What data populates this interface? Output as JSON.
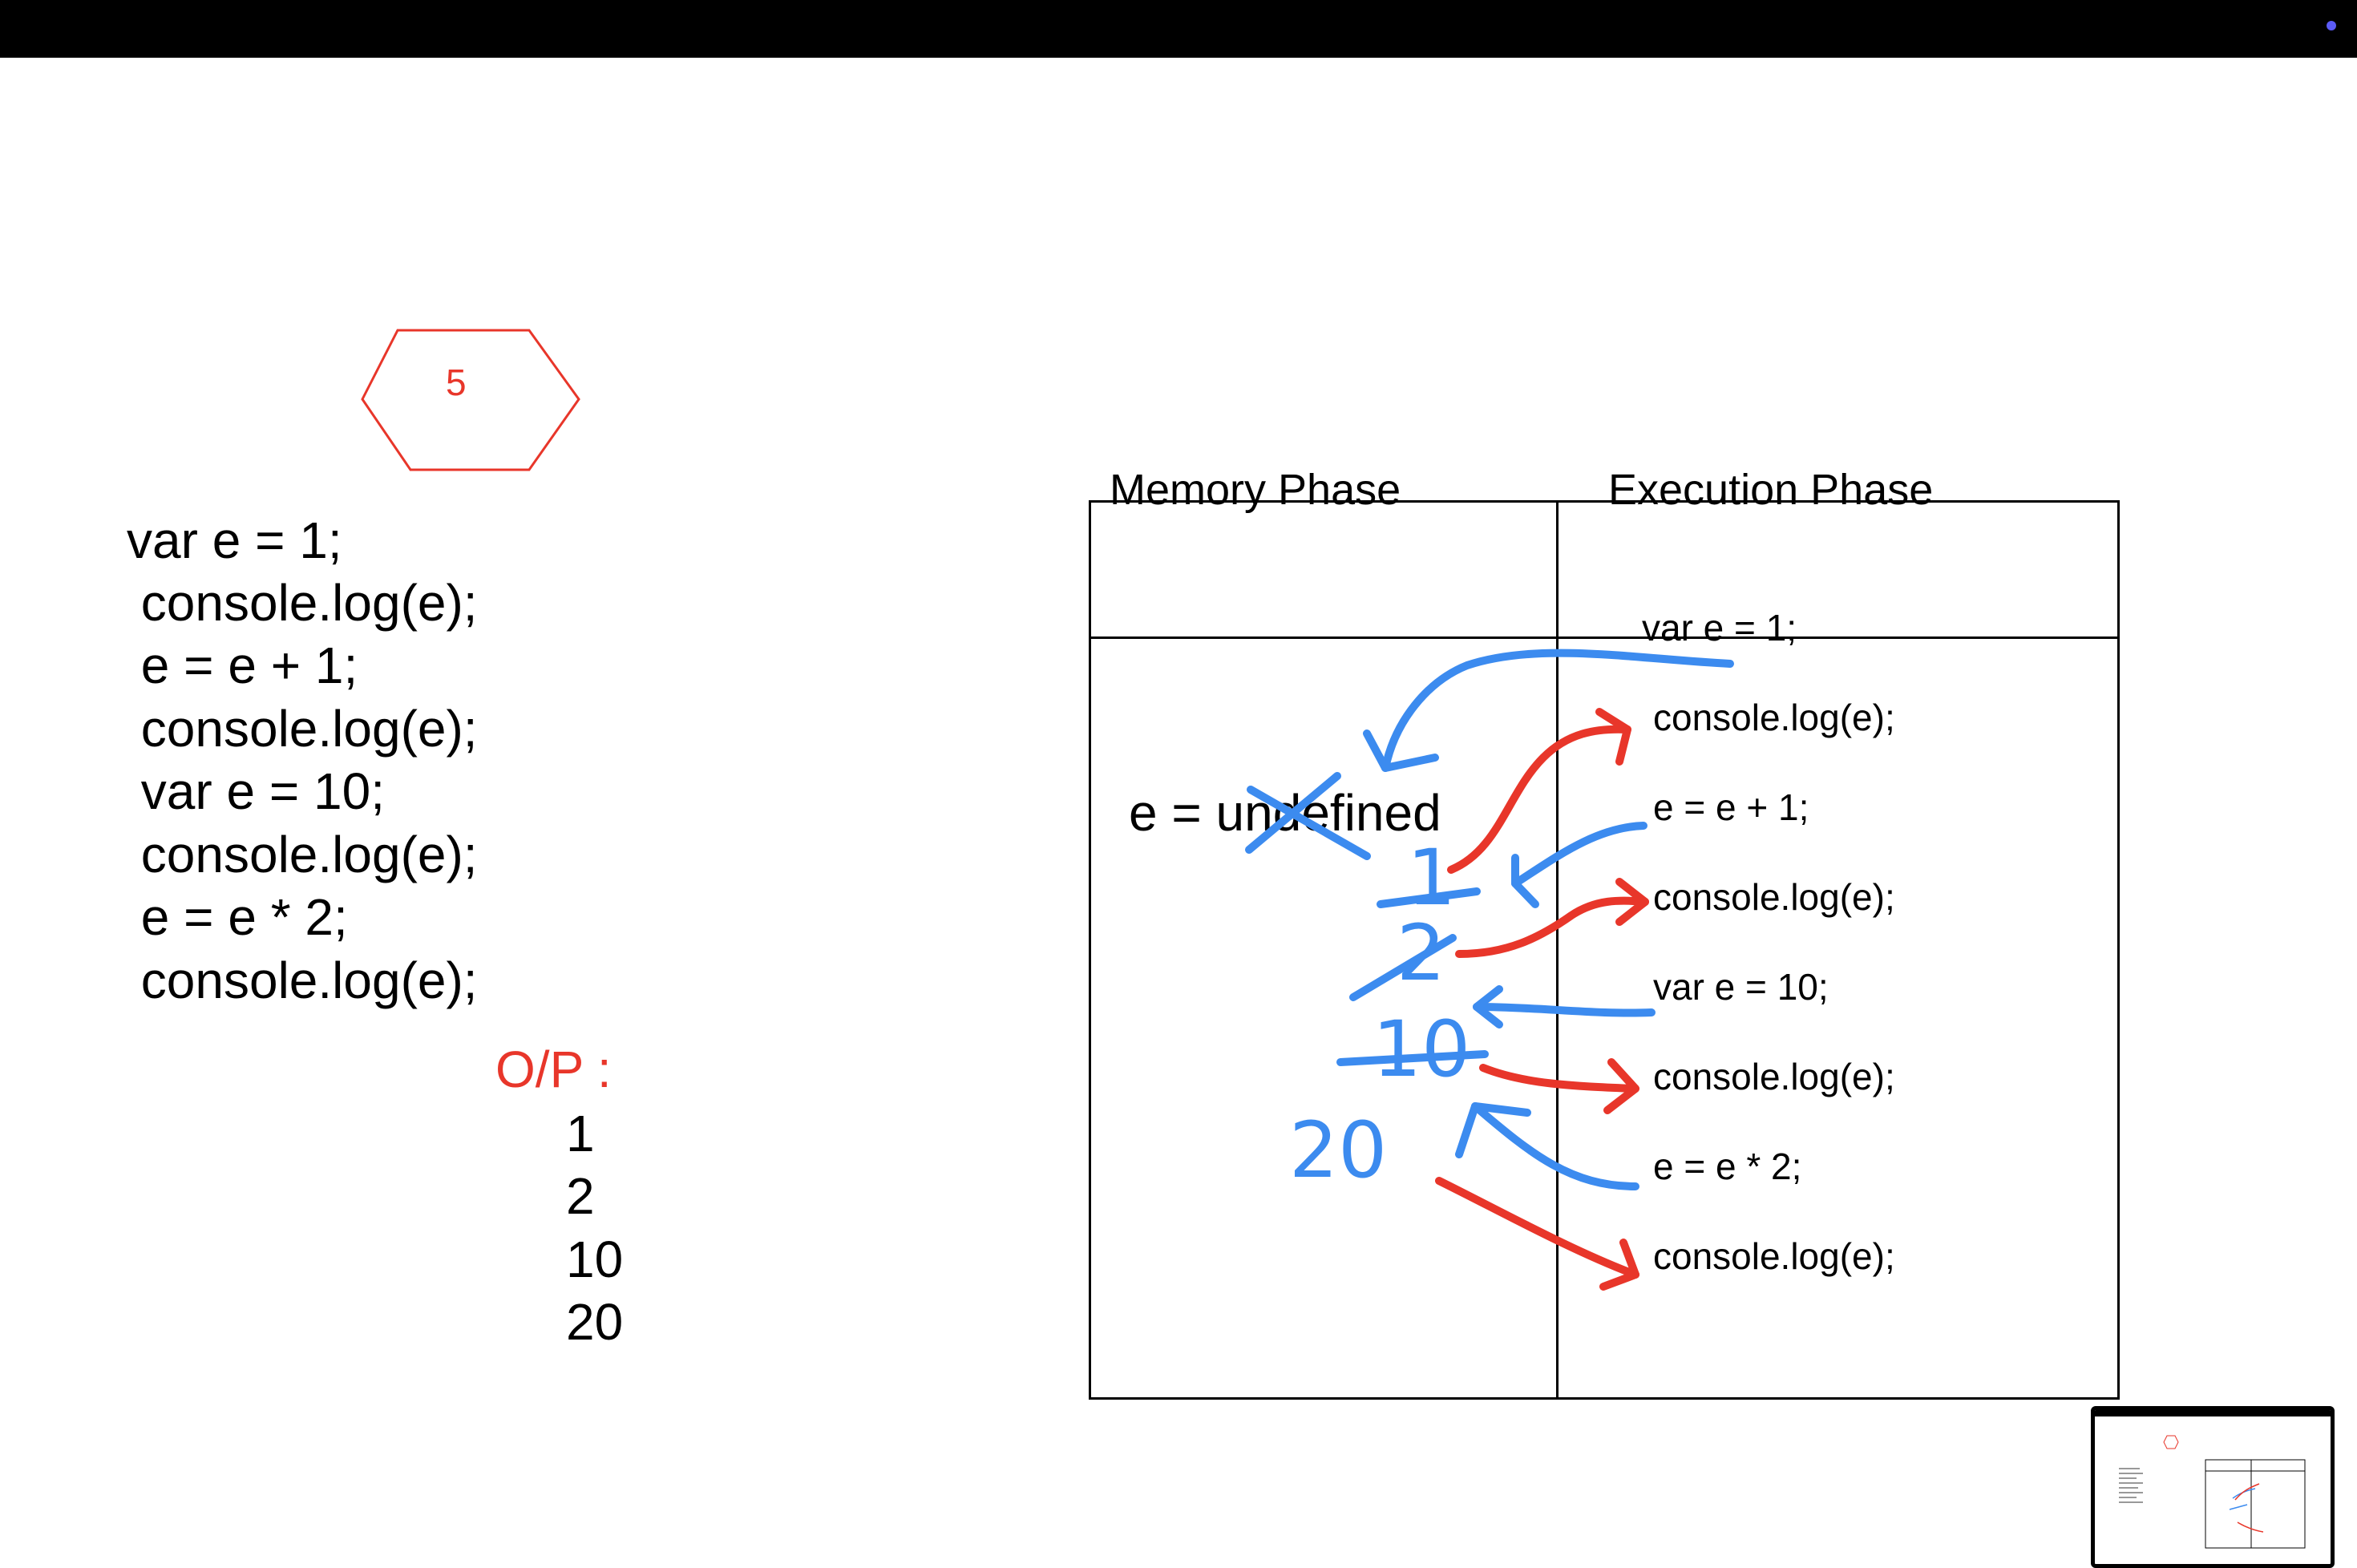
{
  "colors": {
    "accent_red": "#E8362A",
    "ink_blue": "#3C8BEF",
    "topbar": "#000000",
    "topbar_dot": "#5B5BF6"
  },
  "slide": {
    "badge_number": "5",
    "code_lines": [
      "var e = 1;",
      " console.log(e);",
      " e = e + 1;",
      " console.log(e);",
      " var e = 10;",
      " console.log(e);",
      " e = e * 2;",
      " console.log(e);"
    ],
    "output_label": "O/P :",
    "output_values": [
      "1",
      "2",
      "10",
      "20"
    ],
    "table": {
      "memory_header": "Memory Phase",
      "execution_header": "Execution Phase",
      "memory_entry": "e = undefined",
      "execution_rows": [
        "var e = 1;",
        "console.log(e);",
        "e = e + 1;",
        "console.log(e);",
        "var e = 10;",
        "console.log(e);",
        "e = e * 2;",
        "console.log(e);"
      ]
    },
    "handwriting": [
      "1",
      "2",
      "10",
      "20"
    ]
  }
}
